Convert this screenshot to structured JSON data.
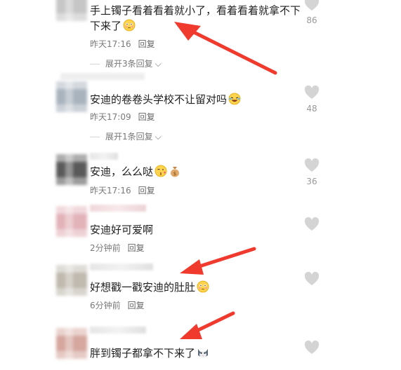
{
  "comments": [
    {
      "text_line1": "手上镯子看着看着就小了，看着看着就拿不下",
      "text_line2": "下来了",
      "time": "昨天17:16",
      "reply": "回复",
      "expand": "展开3条回复",
      "likes": "86",
      "emoji": "flushed-face-icon",
      "avatar_colors": [
        "#bdbdbd",
        "#d9d9d9"
      ]
    },
    {
      "text_line1": "安迪的卷卷头学校不让留对吗",
      "time": "昨天17:09",
      "reply": "回复",
      "expand": "展开1条回复",
      "likes": "48",
      "emoji": "rofl-face-icon",
      "avatar_colors": [
        "#8fa3b8",
        "#9aa0a6"
      ]
    },
    {
      "text_line1": "安迪，么么哒",
      "time": "昨天17:16",
      "reply": "回复",
      "likes": "36",
      "emoji": "kiss-face-icon",
      "emoji2": "money-bag-icon",
      "avatar_colors": [
        "#2b2b2b",
        "#bfbfbf"
      ]
    },
    {
      "text_line1": "安迪好可爱啊",
      "time": "2分钟前",
      "reply": "回复",
      "likes": "",
      "avatar_colors": [
        "#e8b6bd",
        "#d9a3aa"
      ]
    },
    {
      "text_line1": "好想戳一戳安迪的肚肚",
      "time": "6分钟前",
      "reply": "回复",
      "likes": "",
      "emoji": "flushed-face-icon",
      "avatar_colors": [
        "#b8b3a8",
        "#c9c4ba"
      ]
    },
    {
      "text_line1": "胖到镯子都拿不下来了",
      "likes": "",
      "emoji": "cat-face-icon",
      "avatar_colors": [
        "#c98a7e",
        "#e3c6bf"
      ]
    }
  ],
  "colors": {
    "arrow": "#f03a2e",
    "heart": "#cfcfcf"
  }
}
